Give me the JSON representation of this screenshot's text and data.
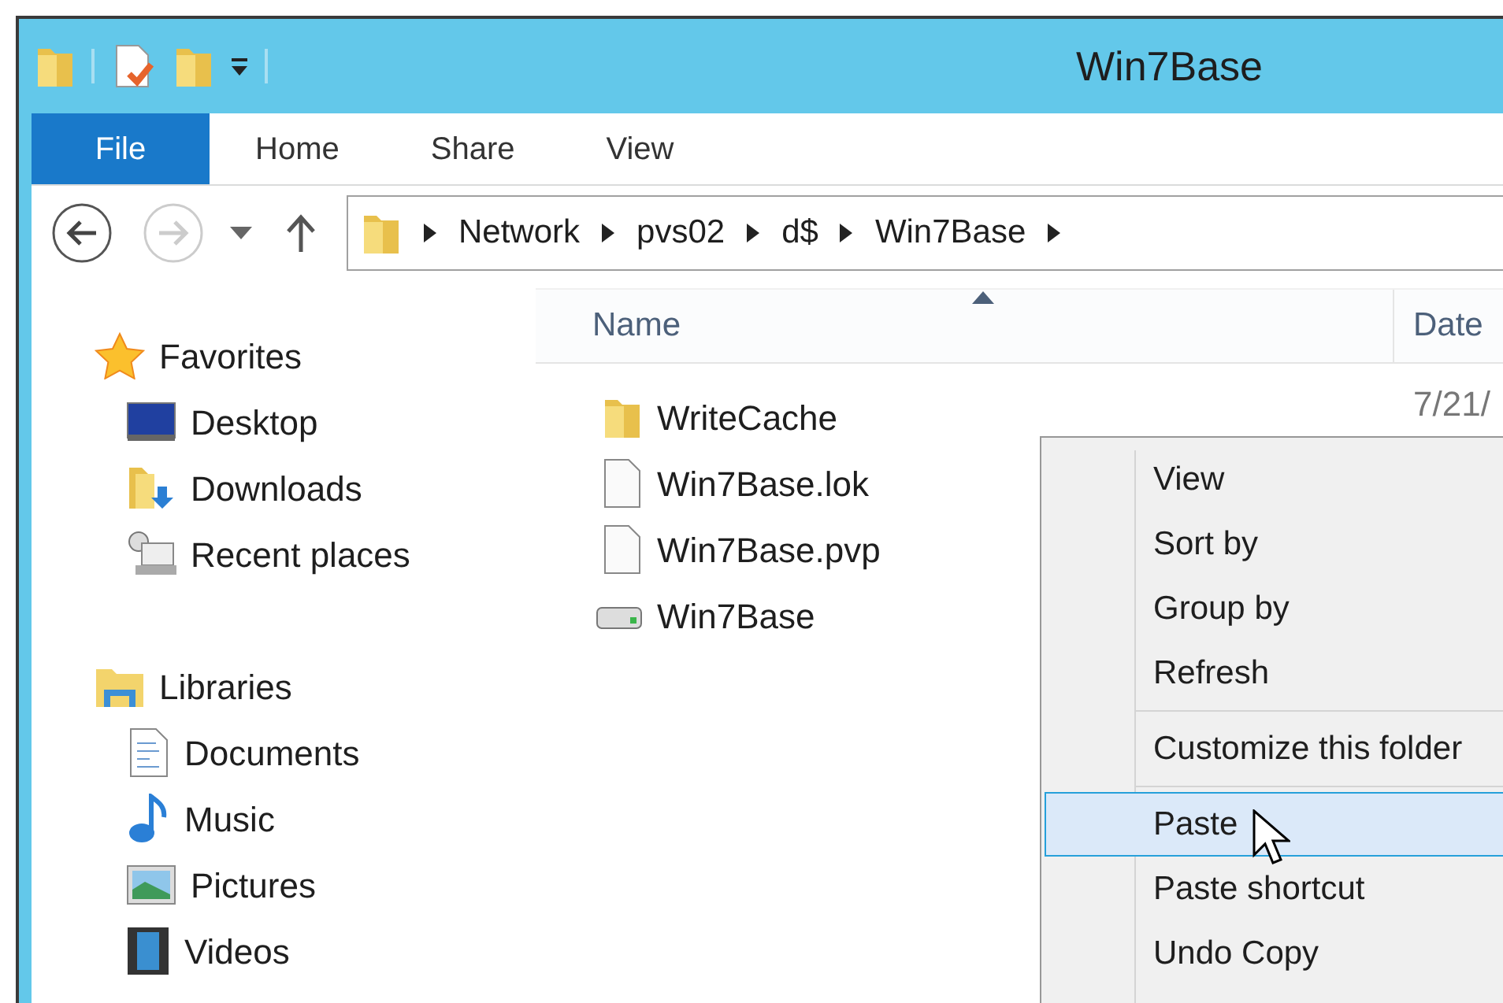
{
  "window": {
    "title": "Win7Base"
  },
  "ribbon_tabs": [
    {
      "label": "File",
      "kind": "file"
    },
    {
      "label": "Home",
      "kind": "tab"
    },
    {
      "label": "Share",
      "kind": "tab"
    },
    {
      "label": "View",
      "kind": "tab"
    }
  ],
  "address_bar": {
    "segments": [
      "Network",
      "pvs02",
      "d$",
      "Win7Base"
    ]
  },
  "navigation": [
    {
      "label": "Favorites",
      "kind": "star",
      "children": [
        {
          "label": "Desktop",
          "kind": "desktop"
        },
        {
          "label": "Downloads",
          "kind": "downloads"
        },
        {
          "label": "Recent places",
          "kind": "recent"
        }
      ]
    },
    {
      "label": "Libraries",
      "kind": "library",
      "children": [
        {
          "label": "Documents",
          "kind": "documents"
        },
        {
          "label": "Music",
          "kind": "music"
        },
        {
          "label": "Pictures",
          "kind": "pictures"
        },
        {
          "label": "Videos",
          "kind": "videos"
        }
      ]
    }
  ],
  "columns": [
    {
      "label": "Name",
      "sorted": true
    },
    {
      "label": "Date",
      "sorted": false
    }
  ],
  "files": [
    {
      "name": "WriteCache",
      "kind": "folder",
      "date": "7/21/"
    },
    {
      "name": "Win7Base.lok",
      "kind": "file"
    },
    {
      "name": "Win7Base.pvp",
      "kind": "file"
    },
    {
      "name": "Win7Base",
      "kind": "drive"
    }
  ],
  "context_menu": [
    {
      "kind": "item",
      "label": "View",
      "selected": false
    },
    {
      "kind": "item",
      "label": "Sort by",
      "selected": false
    },
    {
      "kind": "item",
      "label": "Group by",
      "selected": false
    },
    {
      "kind": "item",
      "label": "Refresh",
      "selected": false
    },
    {
      "kind": "separator"
    },
    {
      "kind": "item",
      "label": "Customize this folder",
      "selected": false
    },
    {
      "kind": "separator"
    },
    {
      "kind": "item",
      "label": "Paste",
      "selected": true
    },
    {
      "kind": "item",
      "label": "Paste shortcut",
      "selected": false
    },
    {
      "kind": "item",
      "label": "Undo Copy",
      "selected": false
    }
  ]
}
